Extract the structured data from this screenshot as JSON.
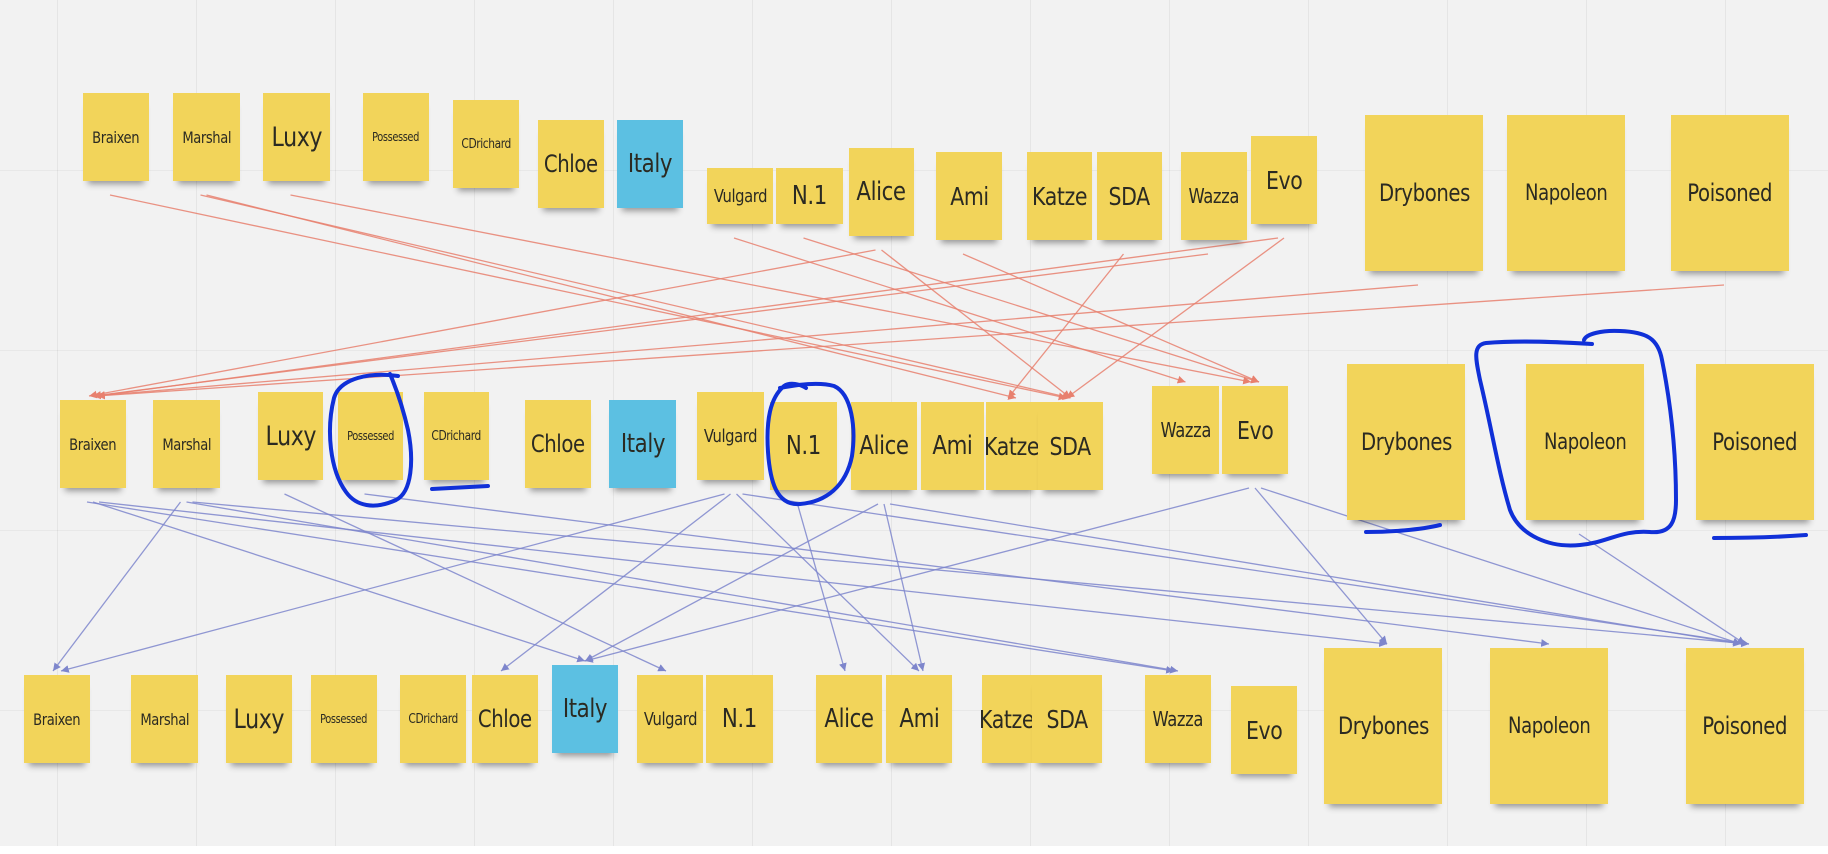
{
  "board": {
    "background_color": "#f2f2f2",
    "sticky_yellow": "#f2d45a",
    "sticky_blue": "#5cc0e2",
    "connector_red": "#e8806e",
    "connector_blue": "#7e86cc",
    "annotation_ink": "#1030d8"
  },
  "rows": [
    {
      "name": "top",
      "notes": [
        {
          "label": "Braixen",
          "color": "yellow"
        },
        {
          "label": "Marshal",
          "color": "yellow"
        },
        {
          "label": "Luxy",
          "color": "yellow"
        },
        {
          "label": "Possessed",
          "color": "yellow"
        },
        {
          "label": "CDrichard",
          "color": "yellow"
        },
        {
          "label": "Chloe",
          "color": "yellow"
        },
        {
          "label": "Italy",
          "color": "blue"
        },
        {
          "label": "Vulgard",
          "color": "yellow"
        },
        {
          "label": "N.1",
          "color": "yellow"
        },
        {
          "label": "Alice",
          "color": "yellow"
        },
        {
          "label": "Ami",
          "color": "yellow"
        },
        {
          "label": "Katze",
          "color": "yellow"
        },
        {
          "label": "SDA",
          "color": "yellow"
        },
        {
          "label": "Wazza",
          "color": "yellow"
        },
        {
          "label": "Evo",
          "color": "yellow"
        },
        {
          "label": "Drybones",
          "color": "yellow"
        },
        {
          "label": "Napoleon",
          "color": "yellow"
        },
        {
          "label": "Poisoned",
          "color": "yellow"
        }
      ]
    },
    {
      "name": "middle",
      "notes": [
        {
          "label": "Braixen",
          "color": "yellow"
        },
        {
          "label": "Marshal",
          "color": "yellow"
        },
        {
          "label": "Luxy",
          "color": "yellow"
        },
        {
          "label": "Possessed",
          "color": "yellow",
          "annotation": "circled"
        },
        {
          "label": "CDrichard",
          "color": "yellow",
          "annotation": "underlined"
        },
        {
          "label": "Chloe",
          "color": "yellow"
        },
        {
          "label": "Italy",
          "color": "blue"
        },
        {
          "label": "Vulgard",
          "color": "yellow"
        },
        {
          "label": "N.1",
          "color": "yellow",
          "annotation": "circled"
        },
        {
          "label": "Alice",
          "color": "yellow"
        },
        {
          "label": "Ami",
          "color": "yellow"
        },
        {
          "label": "Katze",
          "color": "yellow"
        },
        {
          "label": "SDA",
          "color": "yellow"
        },
        {
          "label": "Wazza",
          "color": "yellow"
        },
        {
          "label": "Evo",
          "color": "yellow"
        },
        {
          "label": "Drybones",
          "color": "yellow",
          "annotation": "underlined"
        },
        {
          "label": "Napoleon",
          "color": "yellow",
          "annotation": "circled"
        },
        {
          "label": "Poisoned",
          "color": "yellow",
          "annotation": "underlined"
        }
      ]
    },
    {
      "name": "bottom",
      "notes": [
        {
          "label": "Braixen",
          "color": "yellow"
        },
        {
          "label": "Marshal",
          "color": "yellow"
        },
        {
          "label": "Luxy",
          "color": "yellow"
        },
        {
          "label": "Possessed",
          "color": "yellow"
        },
        {
          "label": "CDrichard",
          "color": "yellow"
        },
        {
          "label": "Chloe",
          "color": "yellow"
        },
        {
          "label": "Italy",
          "color": "blue"
        },
        {
          "label": "Vulgard",
          "color": "yellow"
        },
        {
          "label": "N.1",
          "color": "yellow"
        },
        {
          "label": "Alice",
          "color": "yellow"
        },
        {
          "label": "Ami",
          "color": "yellow"
        },
        {
          "label": "Katze",
          "color": "yellow"
        },
        {
          "label": "SDA",
          "color": "yellow"
        },
        {
          "label": "Wazza",
          "color": "yellow"
        },
        {
          "label": "Evo",
          "color": "yellow"
        },
        {
          "label": "Drybones",
          "color": "yellow"
        },
        {
          "label": "Napoleon",
          "color": "yellow"
        },
        {
          "label": "Poisoned",
          "color": "yellow"
        }
      ]
    }
  ],
  "connections": {
    "top_to_middle": [
      {
        "from": "Braixen",
        "to": "SDA"
      },
      {
        "from": "Marshal",
        "to": "SDA"
      },
      {
        "from": "Marshal",
        "to": "Katze"
      },
      {
        "from": "Luxy",
        "to": "Evo"
      },
      {
        "from": "Vulgard",
        "to": "Wazza"
      },
      {
        "from": "N.1",
        "to": "Evo"
      },
      {
        "from": "Alice",
        "to": "Braixen"
      },
      {
        "from": "Alice",
        "to": "SDA"
      },
      {
        "from": "Ami",
        "to": "Evo"
      },
      {
        "from": "SDA",
        "to": "Katze"
      },
      {
        "from": "Wazza",
        "to": "Braixen"
      },
      {
        "from": "Evo",
        "to": "Braixen"
      },
      {
        "from": "Evo",
        "to": "SDA"
      },
      {
        "from": "Drybones",
        "to": "Braixen"
      },
      {
        "from": "Poisoned",
        "to": "Braixen"
      }
    ],
    "middle_to_bottom": [
      {
        "from": "Braixen",
        "to": "Wazza"
      },
      {
        "from": "Braixen",
        "to": "Italy"
      },
      {
        "from": "Braixen",
        "to": "Drybones"
      },
      {
        "from": "Marshal",
        "to": "Braixen"
      },
      {
        "from": "Marshal",
        "to": "Wazza"
      },
      {
        "from": "Marshal",
        "to": "Poisoned"
      },
      {
        "from": "Luxy",
        "to": "Vulgard"
      },
      {
        "from": "Possessed",
        "to": "Napoleon"
      },
      {
        "from": "Vulgard",
        "to": "Braixen"
      },
      {
        "from": "Vulgard",
        "to": "Chloe"
      },
      {
        "from": "Vulgard",
        "to": "Ami"
      },
      {
        "from": "Vulgard",
        "to": "Poisoned"
      },
      {
        "from": "N.1",
        "to": "Alice"
      },
      {
        "from": "Alice",
        "to": "Italy"
      },
      {
        "from": "Alice",
        "to": "Ami"
      },
      {
        "from": "Alice",
        "to": "Poisoned"
      },
      {
        "from": "Evo",
        "to": "Italy"
      },
      {
        "from": "Evo",
        "to": "Drybones"
      },
      {
        "from": "Evo",
        "to": "Poisoned"
      },
      {
        "from": "Napoleon",
        "to": "Poisoned"
      }
    ]
  }
}
